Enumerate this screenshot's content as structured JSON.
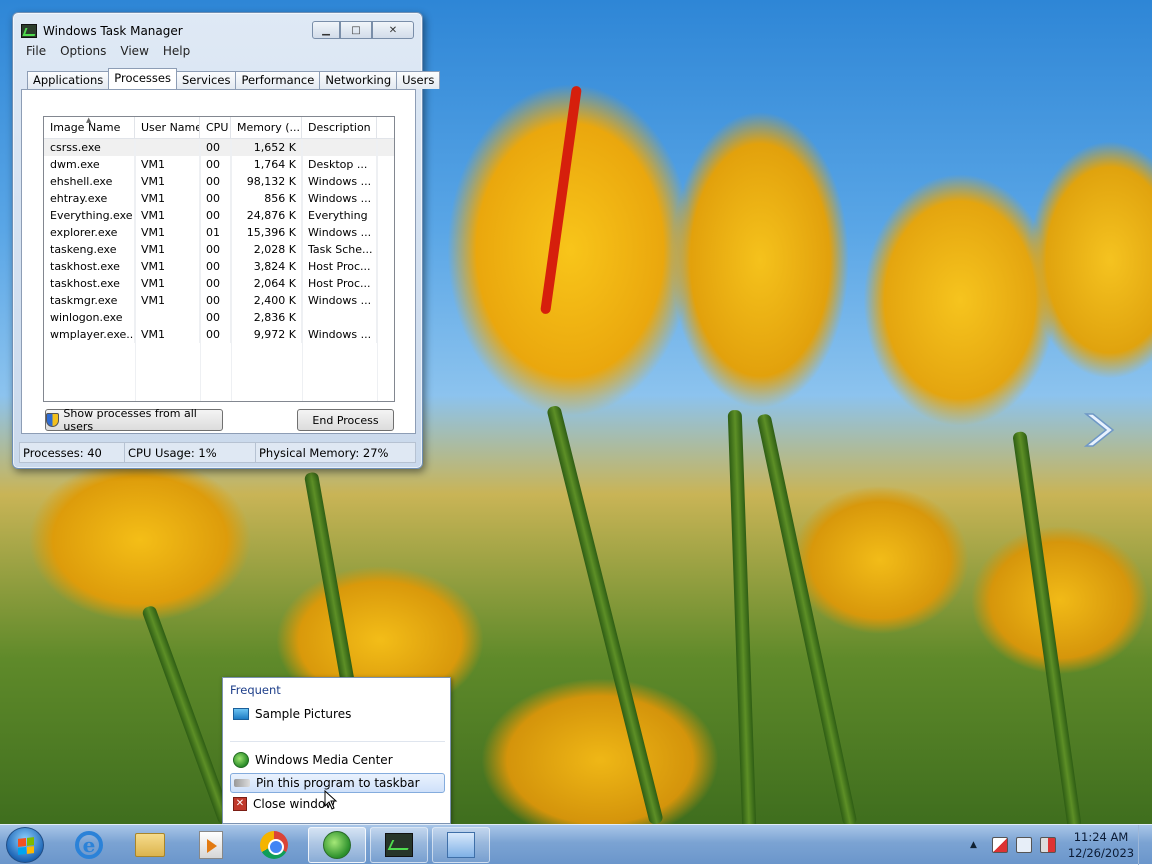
{
  "task_manager": {
    "title": "Windows Task Manager",
    "window_buttons": {
      "minimize": "▁",
      "maximize": "□",
      "close": "✕"
    },
    "menu": [
      "File",
      "Options",
      "View",
      "Help"
    ],
    "tabs": [
      "Applications",
      "Processes",
      "Services",
      "Performance",
      "Networking",
      "Users"
    ],
    "active_tab": "Processes",
    "columns": [
      "Image Name",
      "User Name",
      "CPU",
      "Memory (...",
      "Description"
    ],
    "processes": [
      {
        "image": "csrss.exe",
        "user": "",
        "cpu": "00",
        "memory": "1,652 K",
        "description": ""
      },
      {
        "image": "dwm.exe",
        "user": "VM1",
        "cpu": "00",
        "memory": "1,764 K",
        "description": "Desktop ..."
      },
      {
        "image": "ehshell.exe",
        "user": "VM1",
        "cpu": "00",
        "memory": "98,132 K",
        "description": "Windows ..."
      },
      {
        "image": "ehtray.exe",
        "user": "VM1",
        "cpu": "00",
        "memory": "856 K",
        "description": "Windows ..."
      },
      {
        "image": "Everything.exe",
        "user": "VM1",
        "cpu": "00",
        "memory": "24,876 K",
        "description": "Everything"
      },
      {
        "image": "explorer.exe",
        "user": "VM1",
        "cpu": "01",
        "memory": "15,396 K",
        "description": "Windows ..."
      },
      {
        "image": "taskeng.exe",
        "user": "VM1",
        "cpu": "00",
        "memory": "2,028 K",
        "description": "Task Sche..."
      },
      {
        "image": "taskhost.exe",
        "user": "VM1",
        "cpu": "00",
        "memory": "3,824 K",
        "description": "Host Proc..."
      },
      {
        "image": "taskhost.exe",
        "user": "VM1",
        "cpu": "00",
        "memory": "2,064 K",
        "description": "Host Proc..."
      },
      {
        "image": "taskmgr.exe",
        "user": "VM1",
        "cpu": "00",
        "memory": "2,400 K",
        "description": "Windows ..."
      },
      {
        "image": "winlogon.exe",
        "user": "",
        "cpu": "00",
        "memory": "2,836 K",
        "description": ""
      },
      {
        "image": "wmplayer.exe...",
        "user": "VM1",
        "cpu": "00",
        "memory": "9,972 K",
        "description": "Windows ..."
      }
    ],
    "show_all_button": "Show processes from all users",
    "end_process_button": "End Process",
    "status": {
      "processes": "Processes: 40",
      "cpu": "CPU Usage: 1%",
      "memory": "Physical Memory: 27%"
    }
  },
  "jump_list": {
    "header": "Frequent",
    "frequent_items": [
      "Sample Pictures"
    ],
    "tasks": [
      "Windows Media Center",
      "Pin this program to taskbar",
      "Close window"
    ]
  },
  "taskbar": {
    "apps": [
      "Internet Explorer",
      "Windows Explorer",
      "Windows Media Player",
      "Google Chrome",
      "Windows Media Center",
      "Windows Task Manager",
      "Control Panel"
    ],
    "clock_time": "11:24 AM",
    "clock_date": "12/26/2023",
    "tray_up_arrow": "▲"
  },
  "colors": {
    "taskbar": "#7ba3d3",
    "selection": "#cfe1fa",
    "sky": "#5aa6e6",
    "tulip": "#f5c21c"
  }
}
